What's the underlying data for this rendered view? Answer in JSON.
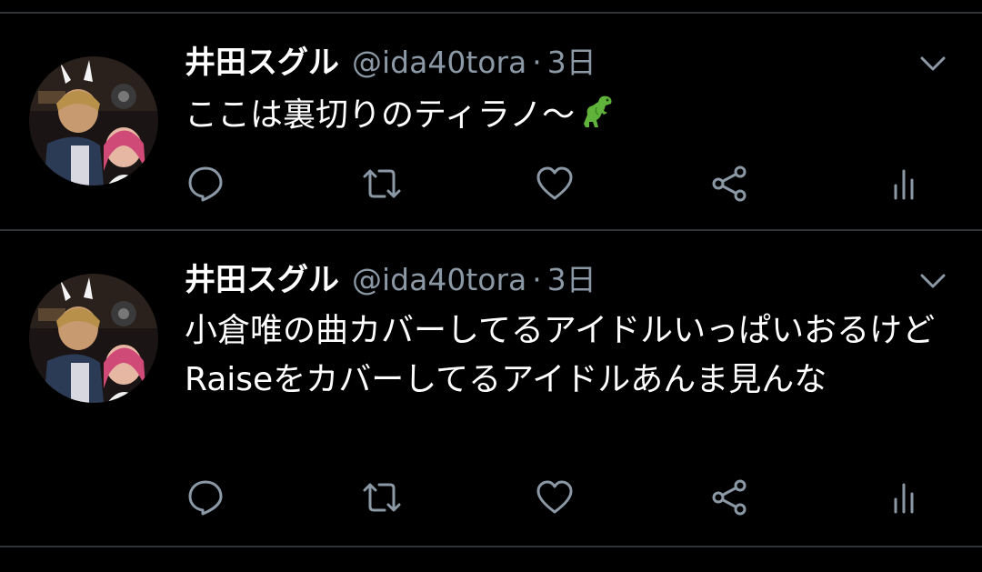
{
  "colors": {
    "background": "#000000",
    "divider": "#2f3336",
    "text_primary": "#ffffff",
    "text_secondary": "#8b98a5"
  },
  "tweets": [
    {
      "author_name": "井田スグル",
      "handle": "@ida40tora",
      "separator": "·",
      "time": "3日",
      "text": "ここは裏切りのティラノ〜",
      "emoji": "t-rex-icon",
      "actions": [
        "reply-icon",
        "retweet-icon",
        "like-icon",
        "share-icon",
        "analytics-icon"
      ]
    },
    {
      "author_name": "井田スグル",
      "handle": "@ida40tora",
      "separator": "·",
      "time": "3日",
      "text": "小倉唯の曲カバーしてるアイドルいっぱいおるけどRaiseをカバーしてるアイドルあんま見んな",
      "actions": [
        "reply-icon",
        "retweet-icon",
        "like-icon",
        "share-icon",
        "analytics-icon"
      ]
    }
  ]
}
